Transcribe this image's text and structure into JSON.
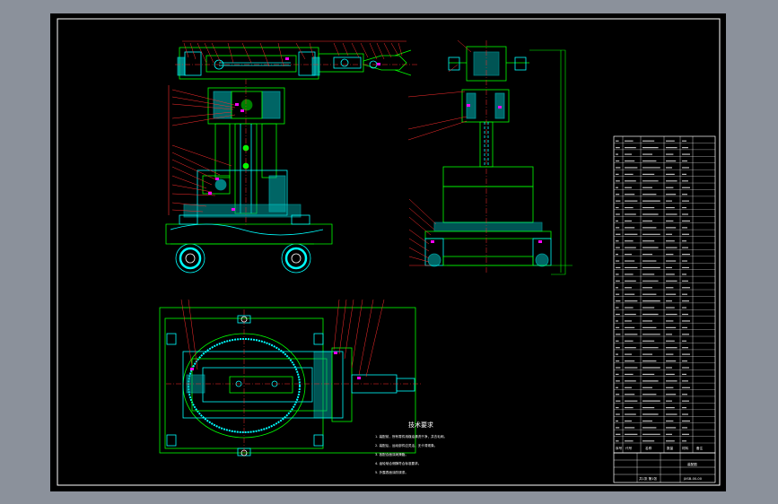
{
  "drawing": {
    "notes_title": "技术要求",
    "notes": [
      "1. 装配前，所有零件用煤油清洗干净，并去毛刺。",
      "2. 装配后，运动部件应灵活，无卡滞现象。",
      "3. 各配合面涂润滑脂。",
      "4. 齿轮啮合侧隙符合标准要求。",
      "5. 外露表面涂防锈漆。"
    ],
    "title_block": {
      "name": "装配图",
      "code": "JXSB-00-00",
      "sheet": "共1张 第1张"
    },
    "bom_header": [
      "序号",
      "代号",
      "名称",
      "数量",
      "材料",
      "备注"
    ],
    "bom_rows": 46
  },
  "colors": {
    "frame": "#ffffff",
    "outline": "#00ff00",
    "section": "#00ffff",
    "accent": "#ff0000",
    "hatch": "#ff00ff",
    "leader": "#ff2d2d",
    "background": "#000000",
    "chrome": "#8b919b"
  }
}
